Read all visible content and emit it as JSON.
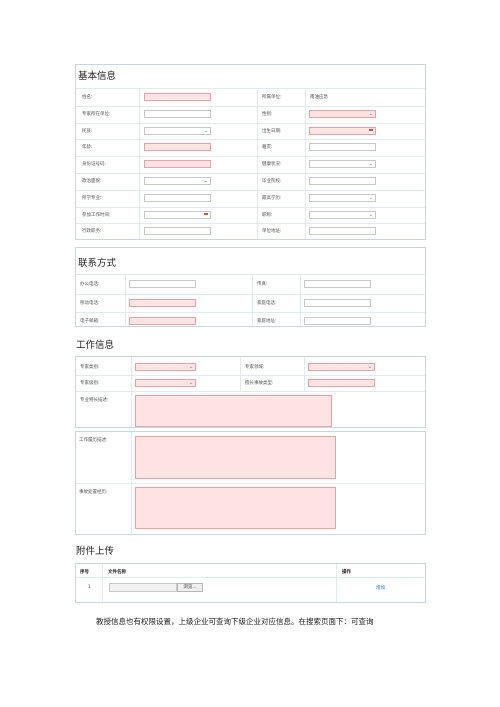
{
  "basic": {
    "title": "基本信息",
    "left_labels": [
      "姓名:",
      "专家所在单位:",
      "民族:",
      "年龄:",
      "身份证号码:",
      "政治面貌:",
      "所学专业:",
      "参加工作时间:",
      "行政职务:"
    ],
    "right_labels": [
      "所属单位:",
      "性别:",
      "出生日期:",
      "籍贯:",
      "健康状况:",
      "毕业院校:",
      "最高学历:",
      "职称:",
      "单位地址:"
    ],
    "unit_value": "南油应急"
  },
  "contact": {
    "title": "联系方式",
    "left_labels": [
      "办公电话:",
      "移动电话:",
      "电子邮箱:"
    ],
    "right_labels": [
      "传真:",
      "家庭电话:",
      "家庭地址:"
    ]
  },
  "work": {
    "title": "工作信息",
    "left_labels": [
      "专家类别:",
      "专家级别:",
      "专业特长描述:"
    ],
    "right_labels": [
      "专家领域:",
      "擅长事故类型:"
    ],
    "history_label": "工作履历描述:",
    "experience_label": "事故处置经历:"
  },
  "attachments": {
    "title": "附件上传",
    "col_no": "序号",
    "col_name": "文件名称",
    "col_action": "操作",
    "row_no": "1",
    "browse_label": "浏览...",
    "add_label": "增加"
  },
  "footer_text": "教授信息也有权限设置，上级企业可查询下级企业对应信息。在搜索页面下：可查询"
}
